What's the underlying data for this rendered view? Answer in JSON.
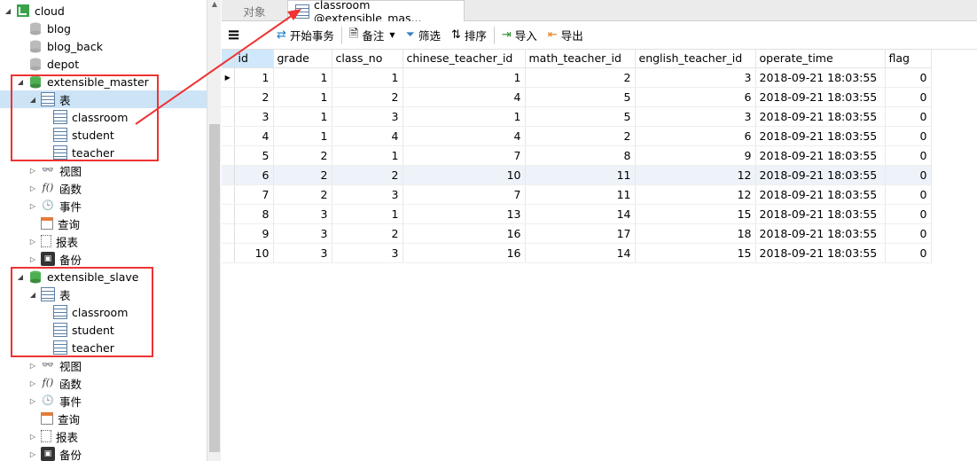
{
  "tree": {
    "root": "cloud",
    "dbs": [
      "blog",
      "blog_back",
      "depot"
    ],
    "master": {
      "name": "extensible_master",
      "tables_group": "表",
      "tables": [
        "classroom",
        "student",
        "teacher"
      ],
      "groups": [
        "视图",
        "函数",
        "事件",
        "查询",
        "报表",
        "备份"
      ]
    },
    "slave": {
      "name": "extensible_slave",
      "tables_group": "表",
      "tables": [
        "classroom",
        "student",
        "teacher"
      ],
      "groups": [
        "视图",
        "函数",
        "事件",
        "查询",
        "报表",
        "备份"
      ]
    }
  },
  "tabs": {
    "objects": "对象",
    "classroom": "classroom @extensible_mas..."
  },
  "toolbar": {
    "menu_icon": "≡",
    "begin_tx": "开始事务",
    "note": "备注",
    "filter": "筛选",
    "sort": "排序",
    "import": "导入",
    "export": "导出"
  },
  "colors": {
    "selected": "#cde4f7",
    "highlight": "#e33",
    "db_icon": "#4caf50"
  },
  "grid": {
    "columns": [
      "id",
      "grade",
      "class_no",
      "chinese_teacher_id",
      "math_teacher_id",
      "english_teacher_id",
      "operate_time",
      "flag"
    ],
    "rows": [
      [
        "1",
        "1",
        "1",
        "1",
        "2",
        "3",
        "2018-09-21 18:03:55",
        "0"
      ],
      [
        "2",
        "1",
        "2",
        "4",
        "5",
        "6",
        "2018-09-21 18:03:55",
        "0"
      ],
      [
        "3",
        "1",
        "3",
        "1",
        "5",
        "3",
        "2018-09-21 18:03:55",
        "0"
      ],
      [
        "4",
        "1",
        "4",
        "4",
        "2",
        "6",
        "2018-09-21 18:03:55",
        "0"
      ],
      [
        "5",
        "2",
        "1",
        "7",
        "8",
        "9",
        "2018-09-21 18:03:55",
        "0"
      ],
      [
        "6",
        "2",
        "2",
        "10",
        "11",
        "12",
        "2018-09-21 18:03:55",
        "0"
      ],
      [
        "7",
        "2",
        "3",
        "7",
        "11",
        "12",
        "2018-09-21 18:03:55",
        "0"
      ],
      [
        "8",
        "3",
        "1",
        "13",
        "14",
        "15",
        "2018-09-21 18:03:55",
        "0"
      ],
      [
        "9",
        "3",
        "2",
        "16",
        "17",
        "18",
        "2018-09-21 18:03:55",
        "0"
      ],
      [
        "10",
        "3",
        "3",
        "16",
        "14",
        "15",
        "2018-09-21 18:03:55",
        "0"
      ]
    ]
  }
}
